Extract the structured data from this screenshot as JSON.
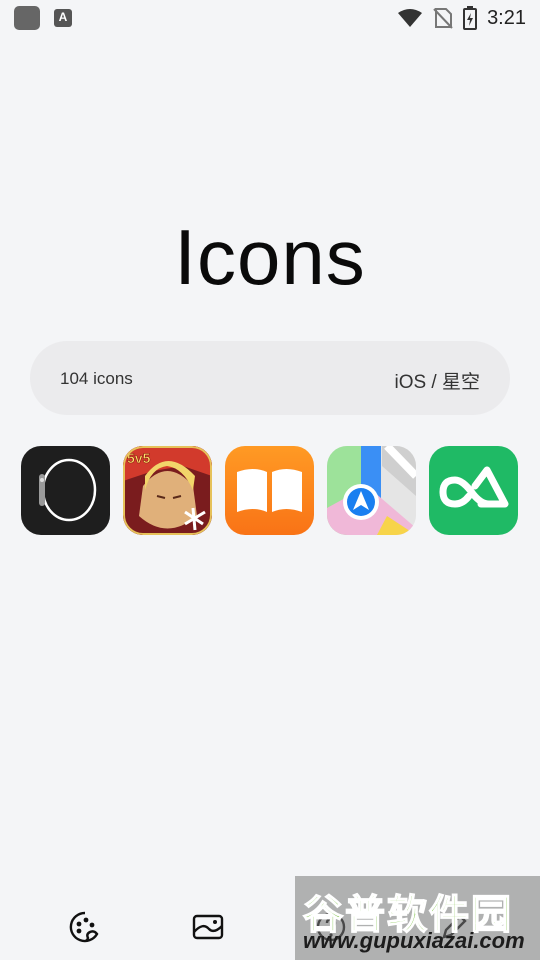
{
  "status_bar": {
    "a_icon": "A",
    "time": "3:21"
  },
  "page": {
    "title": "Icons"
  },
  "pack_info": {
    "count_label": "104 icons",
    "theme_label": "iOS / 星空"
  },
  "icons": [
    {
      "name": "watch-app-icon",
      "bg": "#1e1e1e"
    },
    {
      "name": "honor-of-kings-app-icon",
      "bg": "#b8262a"
    },
    {
      "name": "books-app-icon",
      "bg": "#fa7a14"
    },
    {
      "name": "maps-app-icon",
      "bg": "#e8e8e8"
    },
    {
      "name": "green-arrow-app-icon",
      "bg": "#1fba65"
    }
  ],
  "watermark": {
    "cn": "谷普软件园",
    "url": "www.gupuxiazai.com"
  }
}
